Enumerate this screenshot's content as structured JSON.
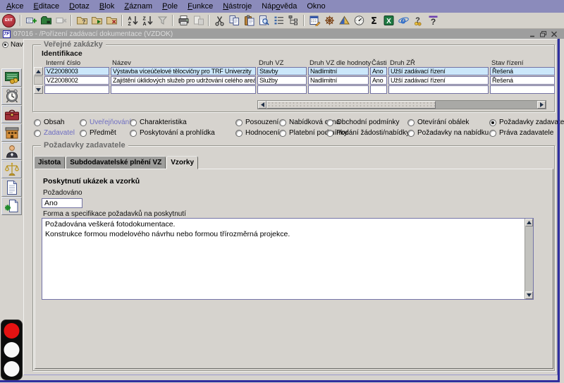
{
  "window": {
    "title": "07016 - /Pořízení zadávací dokumentace (VZDOK)",
    "icon_text": "7F"
  },
  "menu": {
    "items": [
      {
        "pre": "",
        "key": "A",
        "post": "kce"
      },
      {
        "pre": "",
        "key": "E",
        "post": "ditace"
      },
      {
        "pre": "",
        "key": "D",
        "post": "otaz"
      },
      {
        "pre": "",
        "key": "B",
        "post": "lok"
      },
      {
        "pre": "",
        "key": "Z",
        "post": "áznam"
      },
      {
        "pre": "",
        "key": "P",
        "post": "ole"
      },
      {
        "pre": "",
        "key": "F",
        "post": "unkce"
      },
      {
        "pre": "",
        "key": "N",
        "post": "ástroje"
      },
      {
        "pre": "Náp",
        "key": "o",
        "post": "věda"
      },
      {
        "pre": "Okno",
        "key": "",
        "post": ""
      }
    ]
  },
  "toolbar": {
    "exit_label": "EXIT",
    "icon_names": [
      "exit-button",
      "commit-icon",
      "save-icon",
      "rollback-icon",
      "enter-query-icon",
      "execute-query-icon",
      "cancel-query-icon",
      "sort-ascending-icon",
      "sort-descending-icon",
      "filter-icon",
      "print-icon",
      "print-preview-icon",
      "cut-icon",
      "copy-icon",
      "paste-icon",
      "find-icon",
      "list-values-icon",
      "tree-view-icon",
      "calendar-icon",
      "navigator-wheel-icon",
      "prism-icon",
      "gauge-icon",
      "summation-icon",
      "spreadsheet-export-icon",
      "browser-icon",
      "help-topics-icon",
      "window-help-icon"
    ]
  },
  "nav": {
    "label": "Nav",
    "icons": [
      "scoreboard-icon",
      "alarm-clock-icon",
      "toolbox-icon",
      "building-icon",
      "person-icon",
      "scales-icon",
      "document-icon",
      "document-new-icon"
    ],
    "traffic_light": [
      "red",
      "white",
      "white"
    ]
  },
  "zakazky": {
    "group_title": "Veřejné zakázky",
    "section_label": "Identifikace",
    "columns": [
      "Interní číslo",
      "Název",
      "Druh VZ",
      "Druh VZ dle hodnoty",
      "Části",
      "Druh ZŘ",
      "Stav řízení"
    ],
    "rows": [
      [
        "VZ2008003",
        "Výstavba víceúčelové tělocvičny pro TRF Univerzity",
        "Stavby",
        "Nadlimitní",
        "Ano",
        "Užší zadávací řízení",
        "Řešená"
      ],
      [
        "VZ2008002",
        "Zajištění úklidových služeb pro udržování celého areálu Univ",
        "Služby",
        "Nadlimitní",
        "Ano",
        "Užší zadávací řízení",
        "Řešená"
      ]
    ]
  },
  "sections": {
    "row1": [
      {
        "label": "Obsah"
      },
      {
        "label": "Uveřejňování"
      },
      {
        "label": "Charakteristika"
      },
      {
        "label": "Posouzení"
      },
      {
        "label": "Nabídková cena"
      },
      {
        "label": "Obchodní podmínky"
      },
      {
        "label": "Otevírání obálek"
      },
      {
        "label": "Požadavky zadavatele",
        "selected": true
      }
    ],
    "row2": [
      {
        "label": "Zadavatel"
      },
      {
        "label": "Předmět"
      },
      {
        "label": "Poskytování a prohlídka"
      },
      {
        "label": "Hodnocení"
      },
      {
        "label": "Platební podmínky"
      },
      {
        "label": "Podání žádosti/nabídky"
      },
      {
        "label": "Požadavky na nabídku"
      },
      {
        "label": "Práva zadavatele"
      }
    ]
  },
  "pozadavky": {
    "group_title": "Požadavky zadavatele",
    "tabs": [
      "Jistota",
      "Subdodavatelské plnění VZ",
      "Vzorky"
    ],
    "active_tab": "Vzorky",
    "panel": {
      "heading": "Poskytnutí ukázek a vzorků",
      "pozadovano_label": "Požadováno",
      "pozadovano_value": "Ano",
      "forma_label": "Forma a specifikace požadavků na poskytnutí",
      "forma_value": "Požadována veškerá fotodokumentace.\nKonstrukce formou modelového návrhu nebo formou třírozměrná projekce."
    }
  },
  "colors": {
    "menubar": "#8b8bbb",
    "frame_accent": "#2f2f9e",
    "row_highlight": "#cbe7fa",
    "section_link": "#6e6ec2",
    "titlebar": "#9e9e9e"
  }
}
